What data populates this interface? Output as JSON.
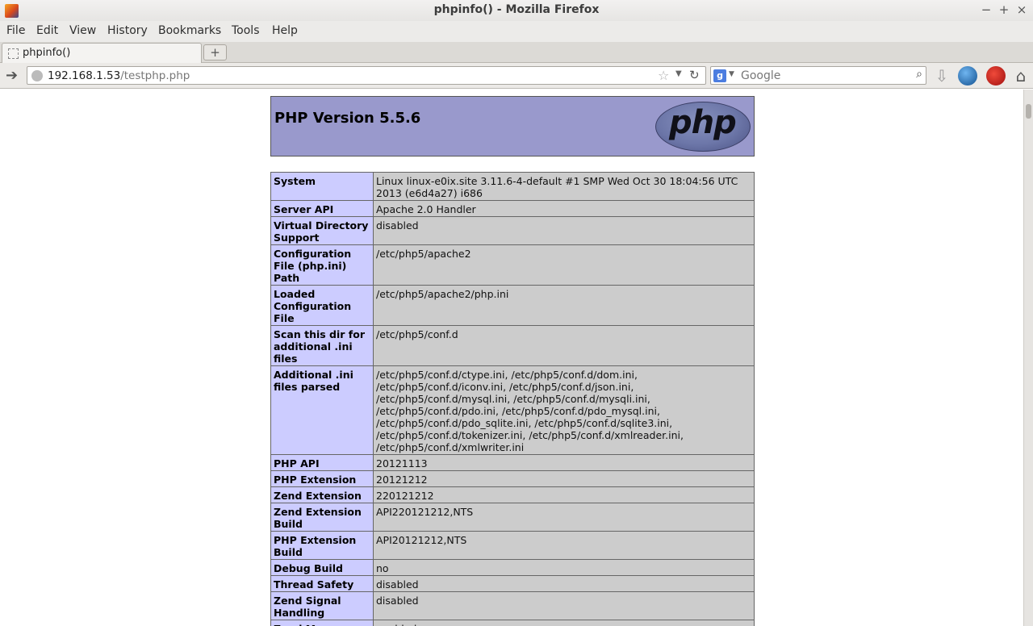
{
  "window": {
    "title": "phpinfo() - Mozilla Firefox",
    "controls": [
      "−",
      "+",
      "×"
    ]
  },
  "menu": {
    "items": [
      "File",
      "Edit",
      "View",
      "History",
      "Bookmarks",
      "Tools",
      "Help"
    ]
  },
  "tabs": [
    {
      "label": "phpinfo()"
    }
  ],
  "newtab_label": "+",
  "nav": {
    "url_host": "192.168.1.53",
    "url_path": "/testphp.php",
    "search_placeholder": "Google",
    "search_engine_glyph": "g"
  },
  "page": {
    "heading": "PHP Version 5.5.6",
    "logo_text": "php",
    "rows": [
      {
        "name": "System",
        "value": "Linux linux-e0ix.site 3.11.6-4-default #1 SMP Wed Oct 30 18:04:56 UTC 2013 (e6d4a27) i686"
      },
      {
        "name": "Server API",
        "value": "Apache 2.0 Handler"
      },
      {
        "name": "Virtual Directory Support",
        "value": "disabled"
      },
      {
        "name": "Configuration File (php.ini) Path",
        "value": "/etc/php5/apache2"
      },
      {
        "name": "Loaded Configuration File",
        "value": "/etc/php5/apache2/php.ini"
      },
      {
        "name": "Scan this dir for additional .ini files",
        "value": "/etc/php5/conf.d"
      },
      {
        "name": "Additional .ini files parsed",
        "value": "/etc/php5/conf.d/ctype.ini, /etc/php5/conf.d/dom.ini, /etc/php5/conf.d/iconv.ini, /etc/php5/conf.d/json.ini, /etc/php5/conf.d/mysql.ini, /etc/php5/conf.d/mysqli.ini, /etc/php5/conf.d/pdo.ini, /etc/php5/conf.d/pdo_mysql.ini, /etc/php5/conf.d/pdo_sqlite.ini, /etc/php5/conf.d/sqlite3.ini, /etc/php5/conf.d/tokenizer.ini, /etc/php5/conf.d/xmlreader.ini, /etc/php5/conf.d/xmlwriter.ini"
      },
      {
        "name": "PHP API",
        "value": "20121113"
      },
      {
        "name": "PHP Extension",
        "value": "20121212"
      },
      {
        "name": "Zend Extension",
        "value": "220121212"
      },
      {
        "name": "Zend Extension Build",
        "value": "API220121212,NTS"
      },
      {
        "name": "PHP Extension Build",
        "value": "API20121212,NTS"
      },
      {
        "name": "Debug Build",
        "value": "no"
      },
      {
        "name": "Thread Safety",
        "value": "disabled"
      },
      {
        "name": "Zend Signal Handling",
        "value": "disabled"
      },
      {
        "name": "Zend Memory Manager",
        "value": "enabled"
      }
    ]
  },
  "colors": {
    "header_bg": "#9999cc",
    "label_bg": "#ccccff",
    "value_bg": "#cccccc"
  },
  "icons": [
    "firefox-icon",
    "back-arrow-icon",
    "globe-icon",
    "bookmark-star-icon",
    "dropdown-icon",
    "reload-icon",
    "google-icon",
    "search-icon",
    "download-icon",
    "thunderbird-icon",
    "addon-icon",
    "home-icon"
  ]
}
